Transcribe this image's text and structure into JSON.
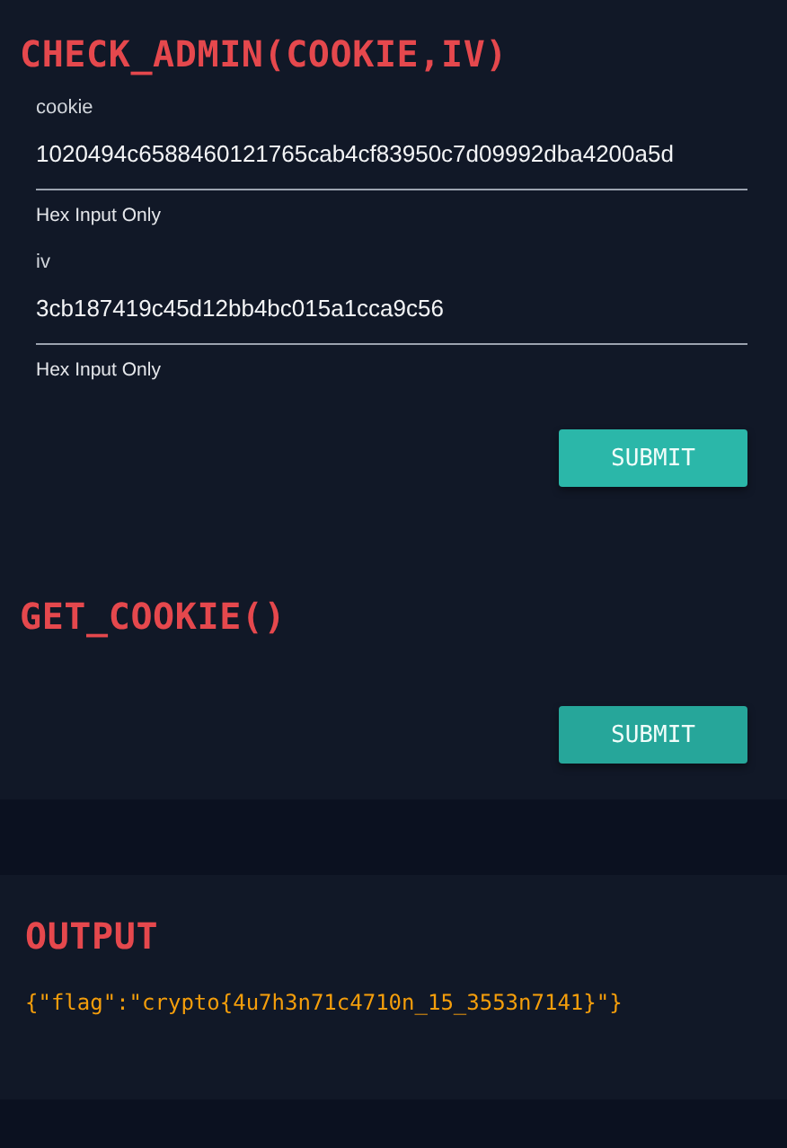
{
  "check_admin": {
    "title": "CHECK_ADMIN(COOKIE,IV)",
    "fields": [
      {
        "label": "cookie",
        "value": "1020494c6588460121765cab4cf83950c7d09992dba4200a5d",
        "helper": "Hex Input Only"
      },
      {
        "label": "iv",
        "value": "3cb187419c45d12bb4bc015a1cca9c56",
        "helper": "Hex Input Only"
      }
    ],
    "button": "SUBMIT"
  },
  "get_cookie": {
    "title": "GET_COOKIE()",
    "button": "SUBMIT"
  },
  "output": {
    "title": "OUTPUT",
    "text": "{\"flag\":\"crypto{4u7h3n71c4710n_15_3553n7141}\"}"
  }
}
